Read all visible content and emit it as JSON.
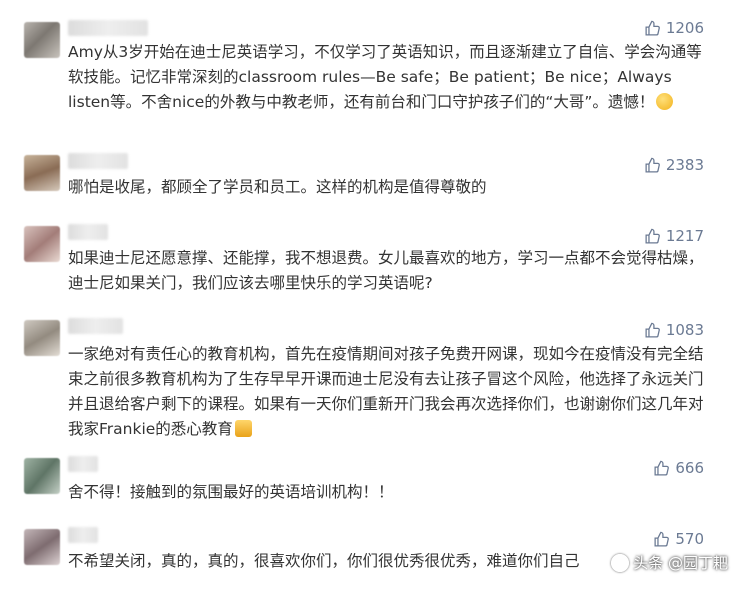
{
  "comments": [
    {
      "likes": "1206",
      "text": "Amy从3岁开始在迪士尼英语学习，不仅学习了英语知识，而且逐渐建立了自信、学会沟通等软技能。记忆非常深刻的classroom rules—Be safe；Be patient；Be nice；Always listen等。不舍nice的外教与中教老师，还有前台和门口守护孩子们的“大哥”。遗憾！",
      "emoji": "crying-face"
    },
    {
      "likes": "2383",
      "text": "哪怕是收尾，都顾全了学员和员工。这样的机构是值得尊敬的"
    },
    {
      "likes": "1217",
      "text": "如果迪士尼还愿意撑、还能撑，我不想退费。女儿最喜欢的地方，学习一点都不会觉得枯燥，迪士尼如果关门，我们应该去哪里快乐的学习英语呢?"
    },
    {
      "likes": "1083",
      "text": "一家绝对有责任心的教育机构，首先在疫情期间对孩子免费开网课，现如今在疫情没有完全结束之前很多教育机构为了生存早早开课而迪士尼没有去让孩子冒这个风险，他选择了永远关门并且退给客户剩下的课程。如果有一天你们重新开门我会再次选择你们，也谢谢你们这几年对我家Frankie的悉心教育",
      "emoji": "thumbs-up"
    },
    {
      "likes": "666",
      "text": "舍不得！接触到的氛围最好的英语培训机构！！"
    },
    {
      "likes": "570",
      "text": "不希望关闭，真的，真的，很喜欢你们，你们很优秀很优秀，难道你们自己"
    }
  ],
  "watermark": "头条 @园丁耙",
  "colors": {
    "like": "#6b7a93",
    "text": "#333333"
  },
  "icons": {
    "like": "thumbs-up-icon"
  }
}
